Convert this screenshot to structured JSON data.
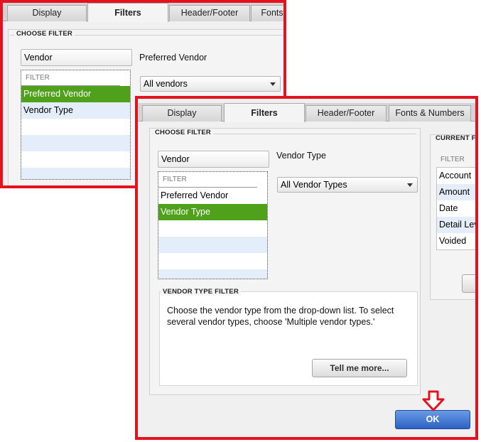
{
  "tabs": {
    "display": "Display",
    "filters": "Filters",
    "header_footer": "Header/Footer",
    "fonts_short": "Fonts",
    "fonts_numbers": "Fonts & Numbers"
  },
  "choose_filter": {
    "heading": "CHOOSE FILTER",
    "search_value": "Vendor",
    "list_heading": "FILTER",
    "items": [
      "Preferred Vendor",
      "Vendor Type"
    ]
  },
  "background_dialog": {
    "selected_filter_label": "Preferred Vendor",
    "dropdown_value": "All vendors"
  },
  "front_dialog": {
    "selected_filter_label": "Vendor Type",
    "dropdown_value": "All Vendor Types",
    "type_filter_heading": "VENDOR TYPE FILTER",
    "type_filter_description": "Choose the vendor type from the drop-down list. To select several vendor types, choose 'Multiple vendor types.'",
    "tell_me_more": "Tell me more...",
    "current_heading": "CURRENT F",
    "current_list_heading": "FILTER",
    "current_items": [
      "Account",
      "Amount",
      "Date",
      "Detail Lev",
      "Voided"
    ],
    "ok_label": "OK"
  },
  "colors": {
    "highlight_border": "#e3121e",
    "selected_row": "#4fa11c",
    "ok_button": "#2c61c4"
  },
  "icons": {
    "pointer": "down-arrow-pointer-icon"
  }
}
